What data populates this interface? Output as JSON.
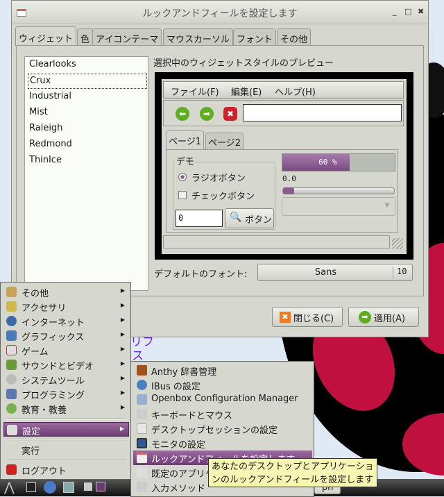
{
  "window": {
    "title": "ルックアンドフィールを設定します",
    "controls": [
      "_",
      "□",
      "✖"
    ]
  },
  "tabs": [
    {
      "label": "ウィジェット",
      "active": true
    },
    {
      "label": "色"
    },
    {
      "label": "アイコンテーマ"
    },
    {
      "label": "マウスカーソル"
    },
    {
      "label": "フォント"
    },
    {
      "label": "その他"
    }
  ],
  "themes": {
    "items": [
      "Clearlooks",
      "Crux",
      "Industrial",
      "Mist",
      "Raleigh",
      "Redmond",
      "ThinIce"
    ],
    "selected": "Crux"
  },
  "preview": {
    "label": "選択中のウィジェットスタイルのプレビュー",
    "menu": [
      "ファイル(F)",
      "編集(E)",
      "ヘルプ(H)"
    ],
    "tabs": [
      "ページ1",
      "ページ2"
    ],
    "frame_label": "デモ",
    "radio": "ラジオボタン",
    "check": "チェックボタン",
    "spin_value": "0",
    "button": "ボタン",
    "progress_text": "60 %",
    "progress": 0.6,
    "scale_value": "0.0",
    "scale": 0.0,
    "accent": "#8a5a90"
  },
  "font": {
    "label": "デフォルトのフォント:",
    "name": "Sans",
    "size": "10"
  },
  "buttons": {
    "close": "閉じる(C)",
    "apply": "適用(A)"
  },
  "desktop": {
    "icon_text1": "リフ",
    "icon_text2": "ス"
  },
  "menu": {
    "items": [
      {
        "label": "その他",
        "icon": "misc-icon"
      },
      {
        "label": "アクセサリ",
        "icon": "accessories-icon"
      },
      {
        "label": "インターネット",
        "icon": "globe-icon"
      },
      {
        "label": "グラフィックス",
        "icon": "graphics-icon"
      },
      {
        "label": "ゲーム",
        "icon": "game-icon"
      },
      {
        "label": "サウンドとビデオ",
        "icon": "sound-icon"
      },
      {
        "label": "システムツール",
        "icon": "system-icon"
      },
      {
        "label": "プログラミング",
        "icon": "programming-icon"
      },
      {
        "label": "教育・教養",
        "icon": "education-icon"
      }
    ],
    "settings": "設定",
    "run": "実行",
    "logout": "ログアウト"
  },
  "submenu": {
    "items": [
      "Anthy 辞書管理",
      "IBus の設定",
      "Openbox Configuration Manager",
      "キーボードとマウス",
      "デスクトップセッションの設定",
      "モニタの設定",
      "ルックアンドフィールを設定します",
      "既定のアプリケーション",
      "入力メソッド"
    ],
    "highlighted": 6
  },
  "tooltip": "あなたのデスクトップとアプリケーションのルックアンドフィールを設定します",
  "taskbar": {
    "task_label": "ph"
  }
}
